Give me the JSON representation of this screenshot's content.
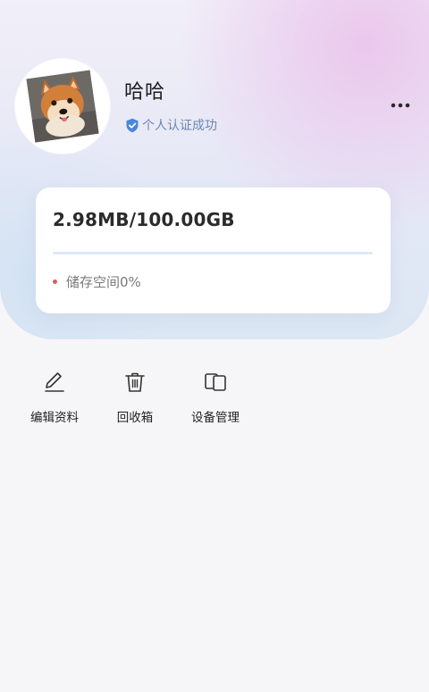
{
  "profile": {
    "username": "哈哈",
    "verify_text": "个人认证成功"
  },
  "storage": {
    "amount": "2.98MB/100.00GB",
    "status": "储存空间0%",
    "progress_fraction": 0.0
  },
  "actions": [
    {
      "label": "编辑资料",
      "icon": "pen-icon"
    },
    {
      "label": "回收箱",
      "icon": "trash-icon"
    },
    {
      "label": "设备管理",
      "icon": "devices-icon"
    }
  ],
  "colors": {
    "verify": "#6c86b2",
    "progress": "#6aa8ef",
    "status_dot": "#e05a5a"
  }
}
